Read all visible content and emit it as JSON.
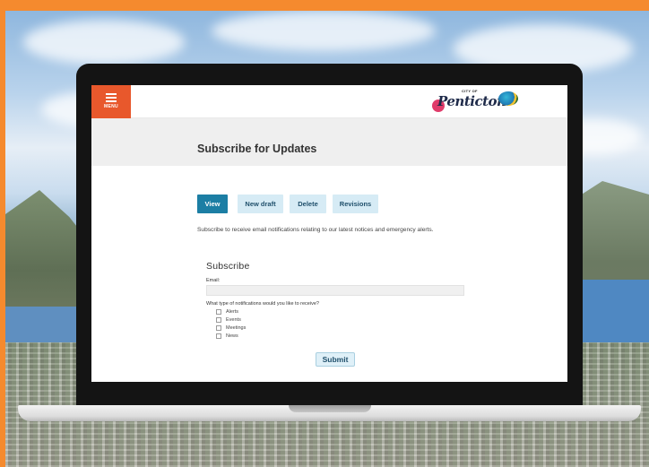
{
  "header": {
    "menu_label": "MENU",
    "logo_small": "CITY OF",
    "logo_text": "Penticton"
  },
  "page": {
    "title": "Subscribe for Updates",
    "intro": "Subscribe to receive email notifications relating to our latest notices and emergency alerts."
  },
  "tabs": [
    {
      "label": "View",
      "active": true
    },
    {
      "label": "New draft",
      "active": false
    },
    {
      "label": "Delete",
      "active": false
    },
    {
      "label": "Revisions",
      "active": false
    }
  ],
  "form": {
    "title": "Subscribe",
    "email_label": "Email:",
    "email_value": "",
    "question": "What type of notifications would you like to receive?",
    "options": [
      "Alerts",
      "Events",
      "Meetings",
      "News"
    ],
    "submit_label": "Submit"
  },
  "colors": {
    "brand_orange": "#e8582c",
    "page_border": "#f58a2e",
    "active_tab": "#1c7ea4",
    "inactive_tab": "#d6ebf5"
  }
}
